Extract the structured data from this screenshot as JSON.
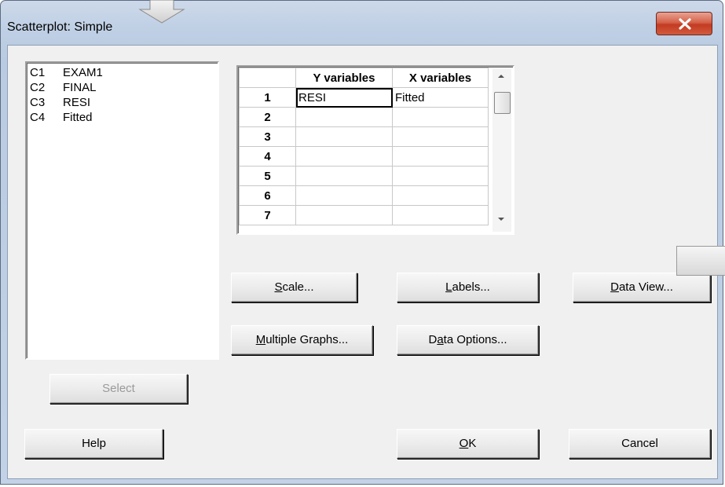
{
  "window": {
    "title": "Scatterplot: Simple"
  },
  "variables": [
    {
      "col": "C1",
      "name": "EXAM1"
    },
    {
      "col": "C2",
      "name": "FINAL"
    },
    {
      "col": "C3",
      "name": "RESI"
    },
    {
      "col": "C4",
      "name": "Fitted"
    }
  ],
  "grid": {
    "headers": {
      "y": "Y variables",
      "x": "X variables"
    },
    "rows": [
      {
        "n": "1",
        "y": "RESI",
        "x": "Fitted"
      },
      {
        "n": "2",
        "y": "",
        "x": ""
      },
      {
        "n": "3",
        "y": "",
        "x": ""
      },
      {
        "n": "4",
        "y": "",
        "x": ""
      },
      {
        "n": "5",
        "y": "",
        "x": ""
      },
      {
        "n": "6",
        "y": "",
        "x": ""
      },
      {
        "n": "7",
        "y": "",
        "x": ""
      }
    ]
  },
  "buttons": {
    "scale": {
      "pre": "",
      "key": "S",
      "post": "cale..."
    },
    "labels": {
      "pre": "",
      "key": "L",
      "post": "abels..."
    },
    "data_view": {
      "pre": "",
      "key": "D",
      "post": "ata View..."
    },
    "multiple_graphs": {
      "pre": "",
      "key": "M",
      "post": "ultiple Graphs..."
    },
    "data_options": {
      "pre": "D",
      "key": "a",
      "post": "ta Options..."
    },
    "select": "Select",
    "help": "Help",
    "ok": {
      "pre": "",
      "key": "O",
      "post": "K"
    },
    "cancel": "Cancel"
  },
  "icons": {
    "close": "close-icon",
    "scroll_up": "scroll-up-arrow-icon",
    "scroll_down": "scroll-down-arrow-icon"
  }
}
